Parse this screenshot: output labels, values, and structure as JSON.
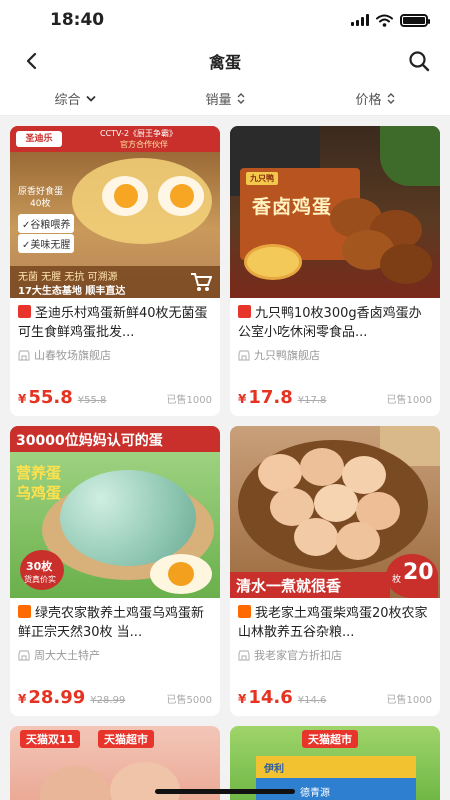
{
  "status_bar": {
    "time": "18:40"
  },
  "nav": {
    "title": "禽蛋"
  },
  "sort": [
    {
      "label": "综合"
    },
    {
      "label": "销量"
    },
    {
      "label": "价格"
    }
  ],
  "colors": {
    "price_red": "#e53322",
    "tmall_red": "#e8352b",
    "taobao_orange": "#ff6a00"
  },
  "products": [
    {
      "title": "圣迪乐村鸡蛋新鲜40枚无菌蛋可生食鲜鸡蛋批发...",
      "shop": "山春牧场旗舰店",
      "price_symbol": "¥",
      "price": "55.8",
      "old_price": "¥55.8",
      "sold": "已售1000",
      "badge_icon": "tmall-badge-icon",
      "img": {
        "brand": "圣迪乐",
        "cctv": "CCTV-2《厨王争霸》",
        "partner": "官方合作伙伴",
        "raw_line1": "原香好食蛋",
        "raw_line2": "40枚",
        "tag1": "✓谷粮喂养",
        "tag2": "✓美味无腥",
        "bottom_line1": "无菌 无腥 无抗    可溯源",
        "bottom_line2": "17大生态基地  顺丰直达"
      }
    },
    {
      "title": "九只鸭10枚300g香卤鸡蛋办公室小吃休闲零食品...",
      "shop": "九只鸭旗舰店",
      "price_symbol": "¥",
      "price": "17.8",
      "old_price": "¥17.8",
      "sold": "已售1000",
      "badge_icon": "tmall-badge-icon",
      "img": {
        "brand": "九只鸭",
        "box_text": "香卤鸡蛋"
      }
    },
    {
      "title": "绿壳农家散养土鸡蛋乌鸡蛋新鲜正宗天然30枚 当...",
      "shop": "周大大土特产",
      "price_symbol": "¥",
      "price": "28.99",
      "old_price": "¥28.99",
      "sold": "已售5000",
      "badge_icon": "taobao-badge-icon",
      "img": {
        "banner": "30000位妈妈认可的蛋",
        "left_line1": "营养蛋",
        "left_line2": "乌鸡蛋",
        "count_line1": "30枚",
        "count_line2": "货真价实"
      }
    },
    {
      "title": "我老家土鸡蛋柴鸡蛋20枚农家山林散养五谷杂粮...",
      "shop": "我老家官方折扣店",
      "price_symbol": "¥",
      "price": "14.6",
      "old_price": "¥14.6",
      "sold": "已售1000",
      "badge_icon": "taobao-badge-icon",
      "img": {
        "slogan": "清水一煮就很香",
        "count": "20",
        "unit": "枚"
      }
    },
    {
      "img": {
        "tag1": "天猫双11",
        "tag2": "天猫超市"
      }
    },
    {
      "img": {
        "tag1": "天猫超市",
        "box1": "伊利",
        "box2": "德青源"
      }
    }
  ]
}
